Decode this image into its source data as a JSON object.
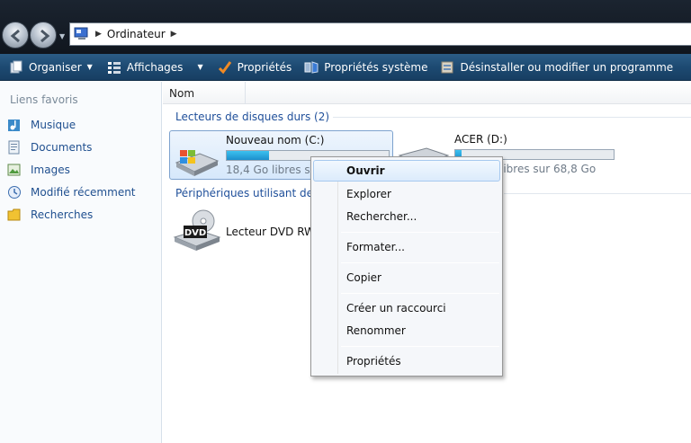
{
  "address": {
    "path_separator": "▶",
    "crumb": "Ordinateur",
    "trail_separator": "▶"
  },
  "toolbar": {
    "items": [
      {
        "label": "Organiser",
        "icon": "organize-icon",
        "caret": "▼"
      },
      {
        "label": "Affichages",
        "icon": "views-icon",
        "caret": "▼"
      },
      {
        "label": "Propriétés",
        "icon": "checkmark-icon"
      },
      {
        "label": "Propriétés système",
        "icon": "system-properties-icon"
      },
      {
        "label": "Désinstaller ou modifier un programme",
        "icon": "uninstall-icon"
      }
    ]
  },
  "sidebar": {
    "title": "Liens favoris",
    "items": [
      {
        "label": "Musique",
        "icon": "music-icon"
      },
      {
        "label": "Documents",
        "icon": "documents-icon"
      },
      {
        "label": "Images",
        "icon": "images-icon"
      },
      {
        "label": "Modifié récemment",
        "icon": "recent-icon"
      },
      {
        "label": "Recherches",
        "icon": "searches-icon"
      }
    ]
  },
  "columns": {
    "name": "Nom"
  },
  "groups": {
    "hard_drives": "Lecteurs de disques durs (2)",
    "removable": "Périphériques utilisant des supports amovibles"
  },
  "drives": [
    {
      "name": "Nouveau nom (C:)",
      "free_text": "18,4 Go libres sur 70,0 Go",
      "used_fraction": 0.26
    },
    {
      "name": "ACER (D:)",
      "free_text": "66,1 Go libres sur 68,8 Go",
      "used_fraction": 0.04
    }
  ],
  "dvd": {
    "name": "Lecteur DVD RW (E:)",
    "icon_label": "DVD"
  },
  "context_menu": {
    "items": [
      "Ouvrir",
      "Explorer",
      "Rechercher...",
      "Formater...",
      "Copier",
      "Créer un raccourci",
      "Renommer",
      "Propriétés"
    ]
  }
}
